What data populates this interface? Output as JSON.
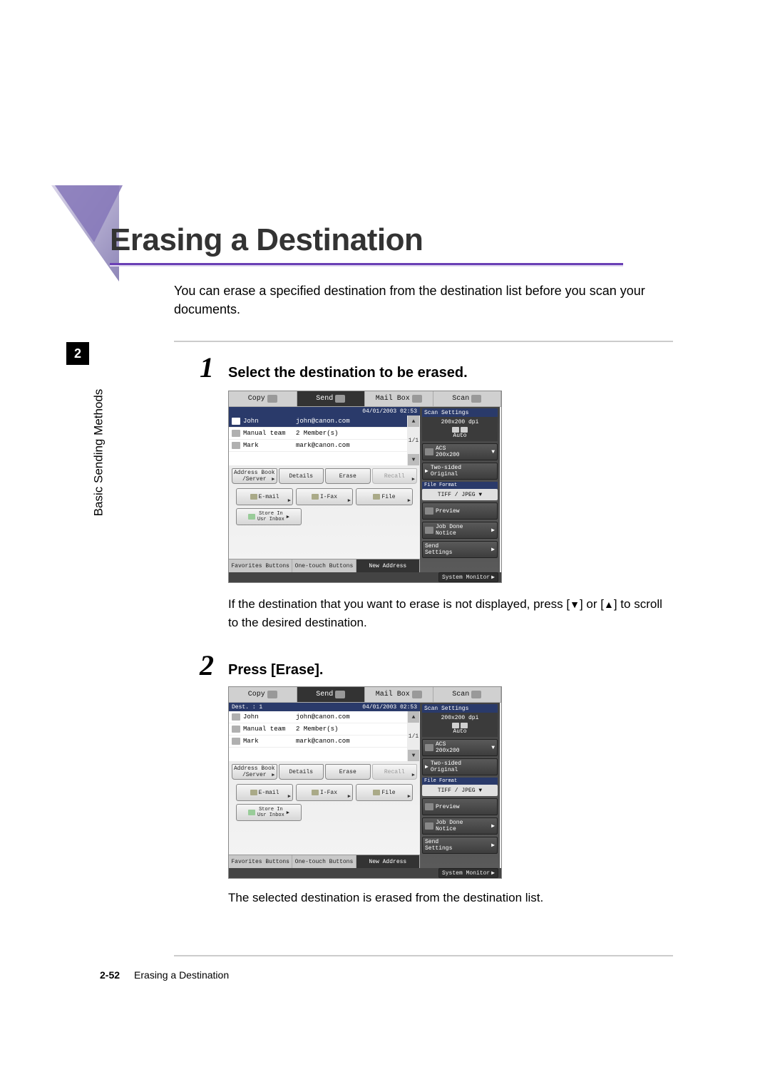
{
  "heading": "Erasing a Destination",
  "intro": "You can erase a specified destination from the destination list before you scan your documents.",
  "chapter": {
    "number": "2",
    "side_label": "Basic Sending Methods"
  },
  "steps": {
    "s1": {
      "num": "1",
      "heading": "Select the destination to be erased.",
      "note_pre": "If the destination that you want to erase is not displayed, press [",
      "note_mid": "] or [",
      "note_post": "] to scroll to the desired destination."
    },
    "s2": {
      "num": "2",
      "heading": "Press [Erase].",
      "note": "The selected destination is erased from the destination list."
    }
  },
  "screenshot": {
    "top_tabs": {
      "copy": "Copy",
      "send": "Send",
      "mailbox": "Mail Box",
      "scan": "Scan"
    },
    "status": {
      "dest_label": "Dest.",
      "dest_count_s2": "1",
      "datetime": "04/01/2003 02:53"
    },
    "dest_rows": [
      {
        "name": "John",
        "detail": "john@canon.com"
      },
      {
        "name": "Manual team",
        "detail": "2 Member(s)"
      },
      {
        "name": "Mark",
        "detail": "mark@canon.com"
      }
    ],
    "page_indicator": "1/1",
    "mid_buttons": {
      "address_book": "Address Book\n/Server",
      "details": "Details",
      "erase": "Erase",
      "recall": "Recall"
    },
    "type_buttons": {
      "email": "E-mail",
      "ifax": "I-Fax",
      "file": "File"
    },
    "store": "Store In\nUsr Inbox",
    "bottom_tabs": {
      "favorites": "Favorites Buttons",
      "onetouch": "One-touch Buttons",
      "new_address": "New Address"
    },
    "right": {
      "title": "Scan Settings",
      "dpi": "200x200 dpi",
      "auto": "Auto",
      "acs": "ACS\n200x200",
      "twosided": "Two-sided\nOriginal",
      "ff_title": "File Format",
      "fileformat": "TIFF / JPEG",
      "preview": "Preview",
      "jobdone": "Job Done\nNotice",
      "sendsettings": "Send\nSettings"
    },
    "system_monitor": "System Monitor"
  },
  "footer": {
    "page": "2-52",
    "title": "Erasing a Destination"
  }
}
